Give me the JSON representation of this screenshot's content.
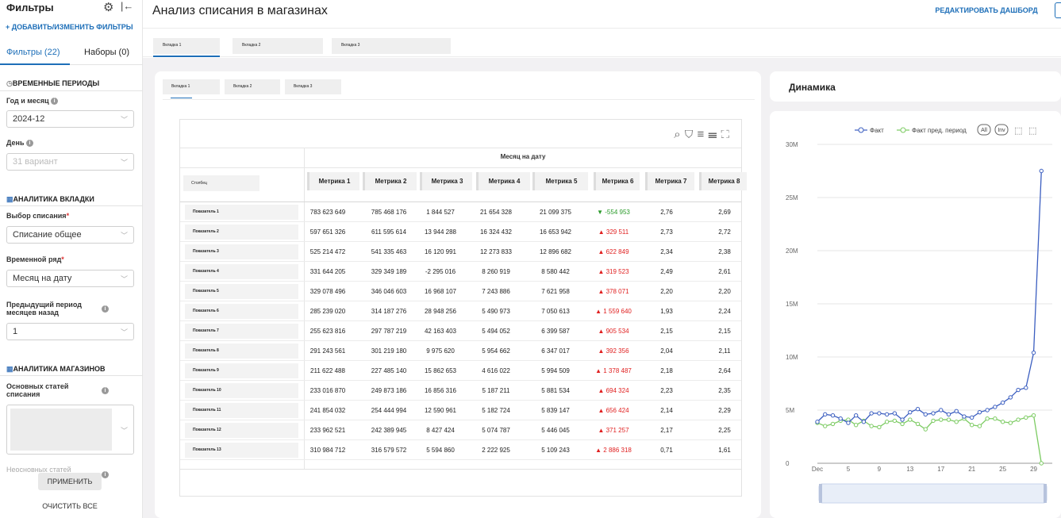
{
  "sidebar": {
    "title": "Фильтры",
    "add_filters": "+ ДОБАВИТЬ/ИЗМЕНИТЬ ФИЛЬТРЫ",
    "tabs": [
      {
        "label": "Фильтры (22)"
      },
      {
        "label": "Наборы (0)"
      }
    ],
    "sections": [
      {
        "label": "ВРЕМЕННЫЕ ПЕРИОДЫ",
        "icon": "clock-icon"
      },
      {
        "label": "АНАЛИТИКА ВКЛАДКИ",
        "icon": "chart-icon"
      },
      {
        "label": "АНАЛИТИКА МАГАЗИНОВ",
        "icon": "chart-icon"
      }
    ],
    "fields": [
      {
        "label": "Год и месяц",
        "value": "2024-12"
      },
      {
        "label": "День",
        "value": "31 вариант"
      },
      {
        "label": "Выбор списания",
        "value": "Списание общее"
      },
      {
        "label": "Временной ряд",
        "value": "Месяц на дату"
      },
      {
        "label": "Предыдущий период месяцев назад",
        "value": "1"
      },
      {
        "label": "Основных статей списания",
        "value": ""
      },
      {
        "label": "Неосновных статей",
        "value": ""
      }
    ],
    "apply": "ПРИМЕНИТЬ",
    "clear": "ОЧИСТИТЬ ВСЕ"
  },
  "header": {
    "title": "Анализ списания в магазинах",
    "edit": "РЕДАКТИРОВАТЬ ДАШБОРД"
  },
  "top_tabs": [
    {
      "label": "Вкладка 1"
    },
    {
      "label": "Вкладка 2"
    },
    {
      "label": "Вкладка 3"
    }
  ],
  "inner_tabs": [
    {
      "label": "Вкладка 1"
    },
    {
      "label": "Вкладка 2"
    },
    {
      "label": "Вкладка 3"
    }
  ],
  "table": {
    "group_header": "Месяц на дату",
    "first_col": "Столбец",
    "columns": [
      "Метрика 1",
      "Метрика 2",
      "Метрика 3",
      "Метрика 4",
      "Метрика 5",
      "Метрика 6",
      "Метрика 7",
      "Метрика 8"
    ],
    "rows": [
      {
        "label": "Показатель 1",
        "v": [
          "783 623 649",
          "785 468 176",
          "1 844 527",
          "21 654 328",
          "21 099 375",
          "▼ -554 953",
          "2,76",
          "2,69"
        ],
        "t": "down"
      },
      {
        "label": "Показатель 2",
        "v": [
          "597 651 326",
          "611 595 614",
          "13 944 288",
          "16 324 432",
          "16 653 942",
          "▲ 329 511",
          "2,73",
          "2,72"
        ],
        "t": "up"
      },
      {
        "label": "Показатель 3",
        "v": [
          "525 214 472",
          "541 335 463",
          "16 120 991",
          "12 273 833",
          "12 896 682",
          "▲ 622 849",
          "2,34",
          "2,38"
        ],
        "t": "up"
      },
      {
        "label": "Показатель 4",
        "v": [
          "331 644 205",
          "329 349 189",
          "-2 295 016",
          "8 260 919",
          "8 580 442",
          "▲ 319 523",
          "2,49",
          "2,61"
        ],
        "t": "up"
      },
      {
        "label": "Показатель 5",
        "v": [
          "329 078 496",
          "346 046 603",
          "16 968 107",
          "7 243 886",
          "7 621 958",
          "▲ 378 071",
          "2,20",
          "2,20"
        ],
        "t": "up"
      },
      {
        "label": "Показатель 6",
        "v": [
          "285 239 020",
          "314 187 276",
          "28 948 256",
          "5 490 973",
          "7 050 613",
          "▲ 1 559 640",
          "1,93",
          "2,24"
        ],
        "t": "up"
      },
      {
        "label": "Показатель 7",
        "v": [
          "255 623 816",
          "297 787 219",
          "42 163 403",
          "5 494 052",
          "6 399 587",
          "▲ 905 534",
          "2,15",
          "2,15"
        ],
        "t": "up"
      },
      {
        "label": "Показатель 8",
        "v": [
          "291 243 561",
          "301 219 180",
          "9 975 620",
          "5 954 662",
          "6 347 017",
          "▲ 392 356",
          "2,04",
          "2,11"
        ],
        "t": "up"
      },
      {
        "label": "Показатель 9",
        "v": [
          "211 622 488",
          "227 485 140",
          "15 862 653",
          "4 616 022",
          "5 994 509",
          "▲ 1 378 487",
          "2,18",
          "2,64"
        ],
        "t": "up"
      },
      {
        "label": "Показатель 10",
        "v": [
          "233 016 870",
          "249 873 186",
          "16 856 316",
          "5 187 211",
          "5 881 534",
          "▲ 694 324",
          "2,23",
          "2,35"
        ],
        "t": "up"
      },
      {
        "label": "Показатель 11",
        "v": [
          "241 854 032",
          "254 444 994",
          "12 590 961",
          "5 182 724",
          "5 839 147",
          "▲ 656 424",
          "2,14",
          "2,29"
        ],
        "t": "up"
      },
      {
        "label": "Показатель 12",
        "v": [
          "233 962 521",
          "242 389 945",
          "8 427 424",
          "5 074 787",
          "5 446 045",
          "▲ 371 257",
          "2,17",
          "2,25"
        ],
        "t": "up"
      },
      {
        "label": "Показатель 13",
        "v": [
          "310 984 712",
          "316 579 572",
          "5 594 860",
          "2 222 925",
          "5 109 243",
          "▲ 2 886 318",
          "0,71",
          "1,61"
        ],
        "t": "up"
      }
    ]
  },
  "dynamics": {
    "title": "Динамика",
    "legend": [
      "Факт",
      "Факт пред. период"
    ],
    "legend_buttons": [
      "All",
      "Inv"
    ],
    "colors": {
      "fact": "#3b5ec0",
      "prev": "#7ccb62"
    }
  },
  "chart_data": {
    "type": "line",
    "title": "Динамика",
    "x": [
      1,
      2,
      3,
      4,
      5,
      6,
      7,
      8,
      9,
      10,
      11,
      12,
      13,
      14,
      15,
      16,
      17,
      18,
      19,
      20,
      21,
      22,
      23,
      24,
      25,
      26,
      27,
      28,
      29,
      30,
      31
    ],
    "x_ticks": [
      "Dec",
      "5",
      "9",
      "13",
      "17",
      "21",
      "25",
      "29"
    ],
    "y_ticks": [
      "0",
      "5M",
      "10M",
      "15M",
      "20M",
      "25M",
      "30M"
    ],
    "ylim": [
      0,
      30000000
    ],
    "series": [
      {
        "name": "Факт",
        "values": [
          3900000,
          4600000,
          4500000,
          4200000,
          3800000,
          4500000,
          3900000,
          4700000,
          4700000,
          4600000,
          4700000,
          4100000,
          4800000,
          5100000,
          4600000,
          4700000,
          5000000,
          4600000,
          4900000,
          4400000,
          4300000,
          4800000,
          5000000,
          5300000,
          5700000,
          6200000,
          6900000,
          7100000,
          10400000,
          27500000
        ]
      },
      {
        "name": "Факт пред. период",
        "values": [
          3800000,
          3500000,
          3700000,
          4000000,
          4100000,
          3600000,
          4000000,
          3500000,
          3400000,
          3900000,
          4000000,
          3700000,
          4100000,
          3700000,
          3200000,
          4000000,
          4100000,
          4100000,
          3900000,
          4200000,
          3600000,
          3500000,
          4200000,
          4200000,
          3900000,
          3800000,
          4100000,
          4300000,
          4500000,
          0
        ]
      }
    ]
  }
}
